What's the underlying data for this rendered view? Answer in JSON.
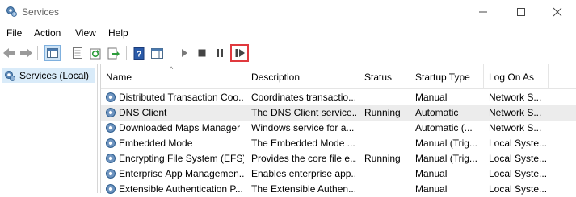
{
  "window": {
    "title": "Services"
  },
  "menu": [
    "File",
    "Action",
    "View",
    "Help"
  ],
  "tree": {
    "selected": "Services (Local)"
  },
  "columns": [
    "Name",
    "Description",
    "Status",
    "Startup Type",
    "Log On As"
  ],
  "rows": [
    {
      "name": "Distributed Transaction Coo...",
      "description": "Coordinates transactio...",
      "status": "",
      "startup": "Manual",
      "logon": "Network S..."
    },
    {
      "name": "DNS Client",
      "description": "The DNS Client service...",
      "status": "Running",
      "startup": "Automatic",
      "logon": "Network S..."
    },
    {
      "name": "Downloaded Maps Manager",
      "description": "Windows service for a...",
      "status": "",
      "startup": "Automatic (...",
      "logon": "Network S..."
    },
    {
      "name": "Embedded Mode",
      "description": "The Embedded Mode ...",
      "status": "",
      "startup": "Manual (Trig...",
      "logon": "Local Syste..."
    },
    {
      "name": "Encrypting File System (EFS)",
      "description": "Provides the core file e...",
      "status": "Running",
      "startup": "Manual (Trig...",
      "logon": "Local Syste..."
    },
    {
      "name": "Enterprise App Managemen...",
      "description": "Enables enterprise app...",
      "status": "",
      "startup": "Manual",
      "logon": "Local Syste..."
    },
    {
      "name": "Extensible Authentication P...",
      "description": "The Extensible Authen...",
      "status": "",
      "startup": "Manual",
      "logon": "Local Syste..."
    }
  ],
  "colors": {
    "selection": "#d9ebf9",
    "row_selected": "#ececec",
    "highlight_box": "#e0393e"
  }
}
